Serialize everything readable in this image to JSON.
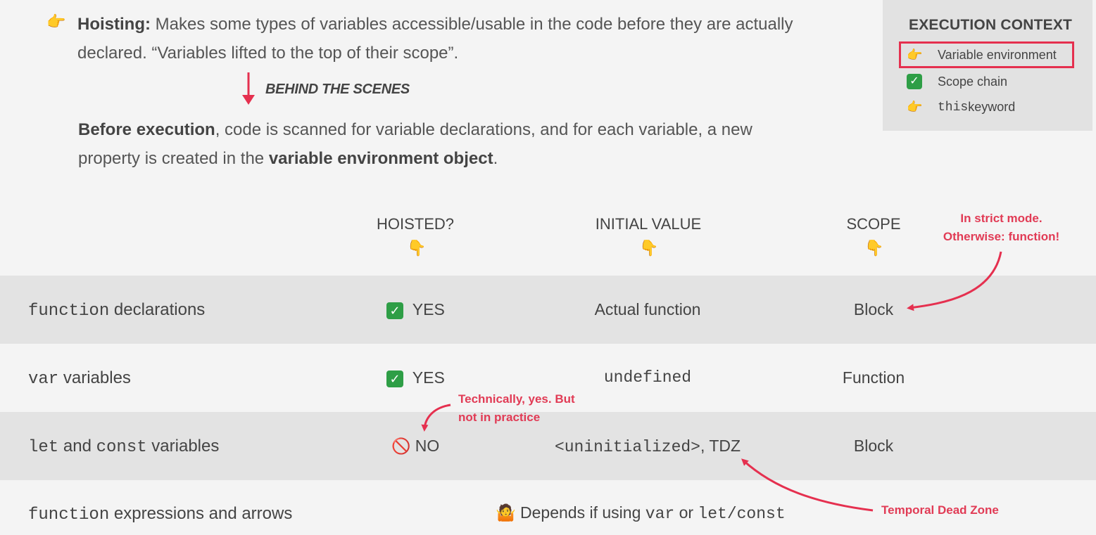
{
  "hoisting": {
    "term": "Hoisting:",
    "description": " Makes some types of variables accessible/usable in the code before they are actually declared. “Variables lifted to the top of their scope”."
  },
  "behind_the_scenes": "BEHIND THE SCENES",
  "before_execution": {
    "bold1": "Before execution",
    "text1": ", code is scanned for variable declarations, and for each variable, a new property is created in the ",
    "bold2": "variable environment object",
    "text2": "."
  },
  "execution_context": {
    "title": "EXECUTION CONTEXT",
    "items": [
      {
        "icon": "pointing-hand-icon",
        "label": "Variable environment"
      },
      {
        "icon": "check-icon",
        "label": "Scope chain"
      },
      {
        "icon": "pointing-hand-icon",
        "label_mono": "this",
        "label": " keyword"
      }
    ]
  },
  "columns": {
    "hoisted": "HOISTED?",
    "initial_value": "INITIAL VALUE",
    "scope": "SCOPE"
  },
  "rows": [
    {
      "label_mono": "function",
      "label": " declarations",
      "hoisted": "YES",
      "initial": "Actual function",
      "scope": "Block"
    },
    {
      "label_mono": "var",
      "label": " variables",
      "hoisted": "YES",
      "initial_mono": "undefined",
      "scope": "Function"
    },
    {
      "label_mono1": "let",
      "label_mid": " and ",
      "label_mono2": "const",
      "label": " variables",
      "hoisted": "NO",
      "initial_mono": "<uninitialized>",
      "initial_suffix": ", TDZ",
      "scope": "Block"
    },
    {
      "label_mono": "function",
      "label": " expressions and arrows",
      "depends_prefix": "Depends if using ",
      "depends_mono1": "var",
      "depends_mid": " or ",
      "depends_mono2": "let/const"
    }
  ],
  "annotations": {
    "strict_mode_line1": "In strict mode.",
    "strict_mode_line2": "Otherwise: function!",
    "technically_line1": "Technically, yes. But",
    "technically_line2": "not in practice",
    "tdz": "Temporal Dead Zone"
  },
  "colors": {
    "accent": "#e5304f",
    "shaded_row": "#e3e3e3",
    "check": "#2e9e46"
  }
}
